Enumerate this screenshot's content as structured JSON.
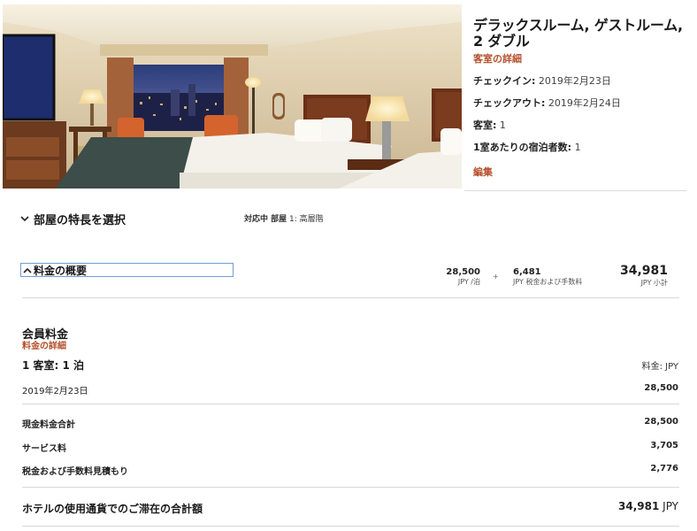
{
  "room": {
    "title": "デラックスルーム, ゲストルーム, 2 ダブル",
    "details_link": "客室の詳細",
    "checkin_label": "チェックイン:",
    "checkin_value": "2019年2月23日",
    "checkout_label": "チェックアウト:",
    "checkout_value": "2019年2月24日",
    "rooms_label": "客室:",
    "rooms_value": "1",
    "guests_label": "1室あたりの宿泊者数:",
    "guests_value": "1",
    "edit_link": "編集"
  },
  "features": {
    "title": "部屋の特長を選択",
    "status_prefix": "対応中 部屋",
    "status_value": "1: 高層階"
  },
  "rate_summary": {
    "label": "料金の概要",
    "nightly_value": "28,500",
    "nightly_unit": "JPY /泊",
    "plus": "+",
    "tax_value": "6,481",
    "tax_unit": "JPY 税金および手数料",
    "subtotal_value": "34,981",
    "subtotal_unit": "JPY 小計"
  },
  "rate_details": {
    "member_rate": "会員料金",
    "rate_detail_link": "料金の詳細",
    "room_night": "1 客室: 1 泊",
    "rate_currency": "料金: JPY",
    "date": "2019年2月23日",
    "date_value": "28,500",
    "cash_total_label": "現金料金合計",
    "cash_total_value": "28,500",
    "service_label": "サービス料",
    "service_value": "3,705",
    "tax_label": "税金および手数料見積もり",
    "tax_value": "2,776",
    "grand_label": "ホテルの使用通貨でのご滞在の合計額",
    "grand_value": "34,981",
    "grand_currency": "JPY"
  },
  "colors": {
    "link": "#b4502b",
    "focus_border": "#6f9ed8"
  }
}
